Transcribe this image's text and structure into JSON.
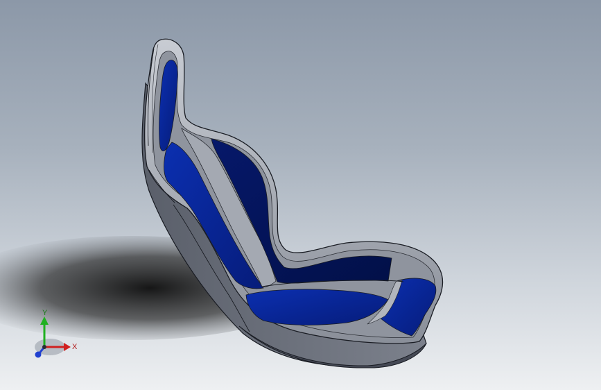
{
  "viewport": {
    "background_top": "#8c98a8",
    "background_bottom": "#eef0f2"
  },
  "model": {
    "shell_color": "#4a4f5c",
    "shell_light": "#9aa0ab",
    "upholstery_color": "#0a2a9e",
    "upholstery_dark": "#04145a",
    "edge_color": "#1a1d24"
  },
  "triad": {
    "x_label": "X",
    "y_label": "Y",
    "x_color": "#d02020",
    "y_color": "#20b020",
    "z_color": "#2040d0"
  }
}
